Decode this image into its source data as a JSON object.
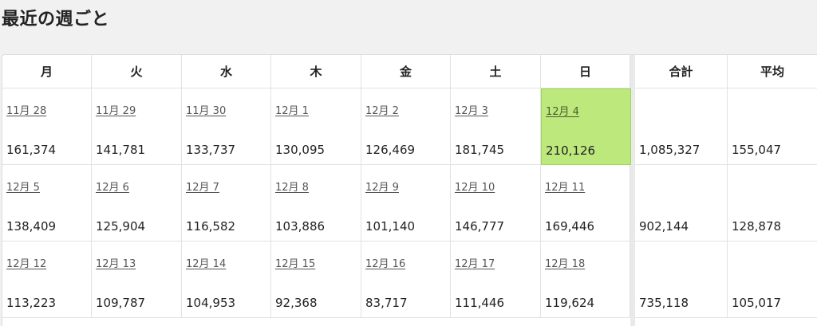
{
  "title": "最近の週ごと",
  "headers": [
    "月",
    "火",
    "水",
    "木",
    "金",
    "土",
    "日",
    "合計",
    "平均"
  ],
  "weeks": [
    {
      "days": [
        {
          "date": "11月 28",
          "value": "161,374"
        },
        {
          "date": "11月 29",
          "value": "141,781"
        },
        {
          "date": "11月 30",
          "value": "133,737"
        },
        {
          "date": "12月 1",
          "value": "130,095"
        },
        {
          "date": "12月 2",
          "value": "126,469"
        },
        {
          "date": "12月 3",
          "value": "181,745"
        },
        {
          "date": "12月 4",
          "value": "210,126"
        }
      ],
      "total": "1,085,327",
      "average": "155,047"
    },
    {
      "days": [
        {
          "date": "12月 5",
          "value": "138,409"
        },
        {
          "date": "12月 6",
          "value": "125,904"
        },
        {
          "date": "12月 7",
          "value": "116,582"
        },
        {
          "date": "12月 8",
          "value": "103,886"
        },
        {
          "date": "12月 9",
          "value": "101,140"
        },
        {
          "date": "12月 10",
          "value": "146,777"
        },
        {
          "date": "12月 11",
          "value": "169,446"
        }
      ],
      "total": "902,144",
      "average": "128,878"
    },
    {
      "days": [
        {
          "date": "12月 12",
          "value": "113,223"
        },
        {
          "date": "12月 13",
          "value": "109,787"
        },
        {
          "date": "12月 14",
          "value": "104,953"
        },
        {
          "date": "12月 15",
          "value": "92,368"
        },
        {
          "date": "12月 16",
          "value": "83,717"
        },
        {
          "date": "12月 17",
          "value": "111,446"
        },
        {
          "date": "12月 18",
          "value": "119,624"
        }
      ],
      "total": "735,118",
      "average": "105,017"
    }
  ],
  "colors": {
    "highlight": "#bde87c",
    "highlight_border": "#9fd55a"
  }
}
